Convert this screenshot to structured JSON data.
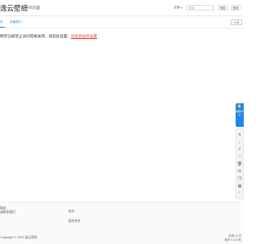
{
  "header": {
    "logo": "逸云壁纸",
    "nav_title": "字的页面",
    "search_select": "全部",
    "search_placeholder": "搜索",
    "search_button": "搜索",
    "login_button": "登录"
  },
  "tabs": {
    "first": "页",
    "second": "页面提示",
    "write_button": "写"
  },
  "notice": {
    "text": "网页已被禁止访问或被关闭，请前往设置：",
    "link": "前往到站点设置"
  },
  "side": {
    "bubble_text": "帮助中心"
  },
  "footer": {
    "col1_line1": "网站",
    "col1_line2": "请联系我们",
    "col2_line1": "合作",
    "col2_line2": "宣传合作",
    "copyright": "Copyright © 2025 逸云壁纸",
    "stats_line1": "查询 14 次",
    "stats_line2": "耗时 0.023 秒"
  },
  "colors": {
    "accent": "#1e88e5",
    "link_red": "#e53935"
  }
}
